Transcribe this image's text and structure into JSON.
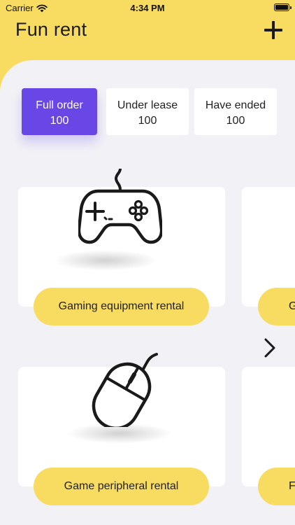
{
  "status_bar": {
    "carrier": "Carrier",
    "time": "4:34 PM"
  },
  "header": {
    "title": "Fun rent",
    "add_icon": "plus-icon"
  },
  "tabs": [
    {
      "label": "Full order",
      "count": "100",
      "active": true
    },
    {
      "label": "Under lease",
      "count": "100",
      "active": false
    },
    {
      "label": "Have ended",
      "count": "100",
      "active": false
    }
  ],
  "categories": [
    {
      "label": "Gaming equipment rental",
      "icon": "gamepad-icon"
    },
    {
      "label": "Game peripheral rental",
      "icon": "mouse-icon"
    }
  ],
  "partial_categories": [
    {
      "label": "G"
    },
    {
      "label": "F"
    }
  ],
  "nav": {
    "next_icon": "chevron-right-icon"
  },
  "colors": {
    "accent": "#6847e6",
    "brand_yellow": "#f8dc62",
    "background": "#f2f2f6",
    "card": "#ffffff"
  }
}
